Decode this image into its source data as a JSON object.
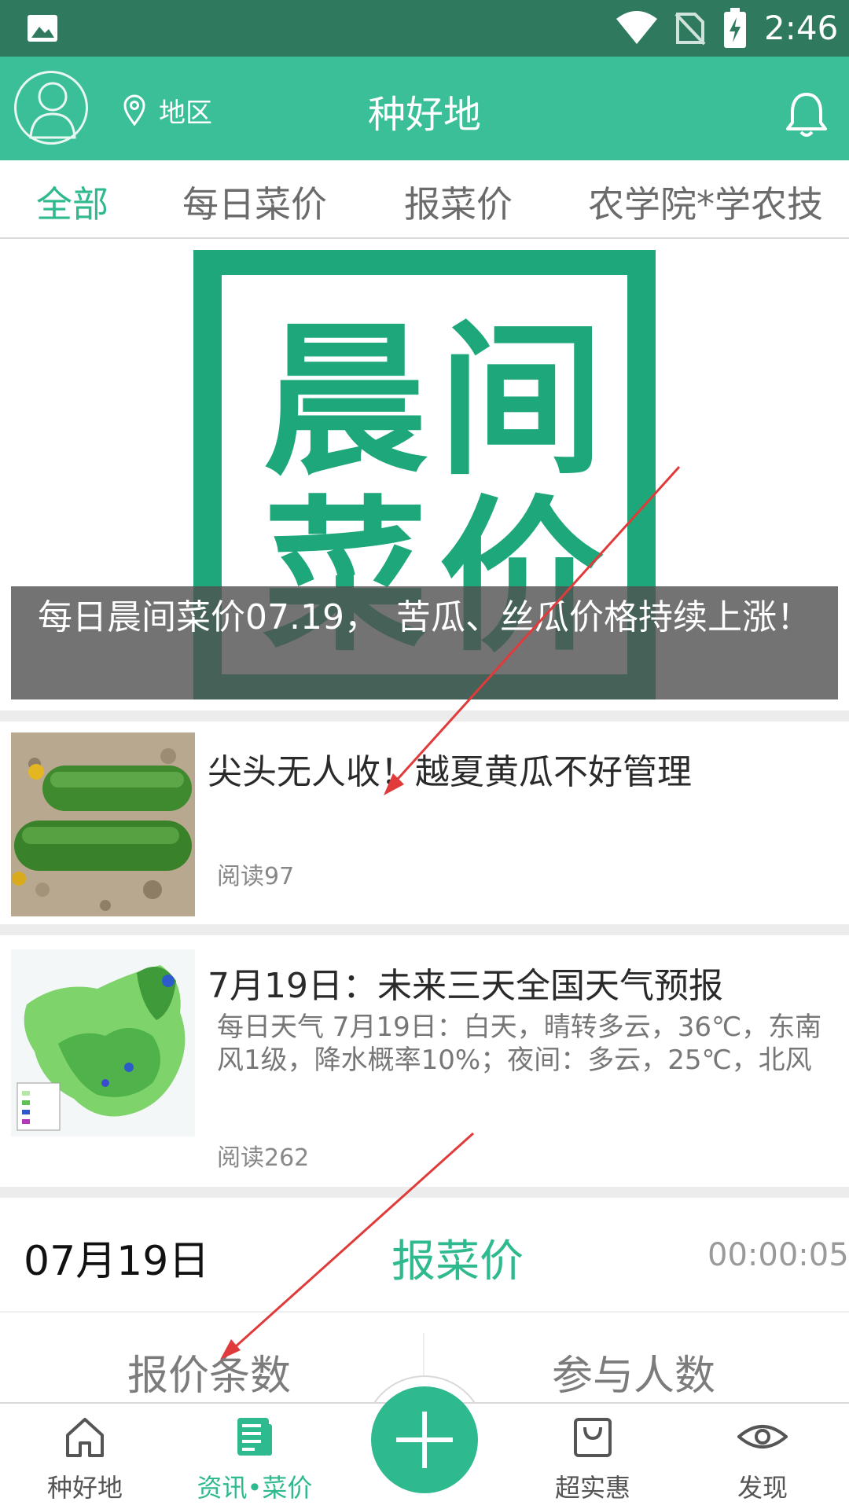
{
  "status_bar": {
    "time": "2:46"
  },
  "header": {
    "region_label": "地区",
    "title": "种好地"
  },
  "tabs": [
    {
      "label": "全部",
      "active": true
    },
    {
      "label": "每日菜价",
      "active": false
    },
    {
      "label": "报菜价",
      "active": false
    },
    {
      "label": "农学院*学农技",
      "active": false
    }
  ],
  "banner": {
    "logo_chars": [
      "晨",
      "间",
      "菜",
      "价"
    ],
    "caption": "每日晨间菜价07.19，　苦瓜、丝瓜价格持续上涨！"
  },
  "news": [
    {
      "title": "尖头无人收！越夏黄瓜不好管理",
      "desc": "",
      "read": "阅读97"
    },
    {
      "title": "7月19日：未来三天全国天气预报",
      "desc": "每日天气 7月19日：白天，晴转多云，36℃，东南风1级，降水概率10%；夜间：多云，25℃，北风",
      "read": "阅读262"
    }
  ],
  "price_panel": {
    "date": "07月19日",
    "title": "报菜价",
    "timer": "00:00:05",
    "stat_left": "报价条数",
    "stat_right": "参与人数"
  },
  "bottom_nav": [
    {
      "label": "种好地",
      "icon": "home-icon"
    },
    {
      "label": "资讯•菜价",
      "icon": "news-icon",
      "active": true
    },
    {
      "label": "超实惠",
      "icon": "shopping-bag-icon"
    },
    {
      "label": "发现",
      "icon": "eye-icon"
    }
  ],
  "colors": {
    "accent": "#3bbf98",
    "accent_text": "#2fb98e",
    "status_bar": "#2f7a5e",
    "banner_green": "#1da77a",
    "annotation_arrow": "#e03a3a"
  }
}
